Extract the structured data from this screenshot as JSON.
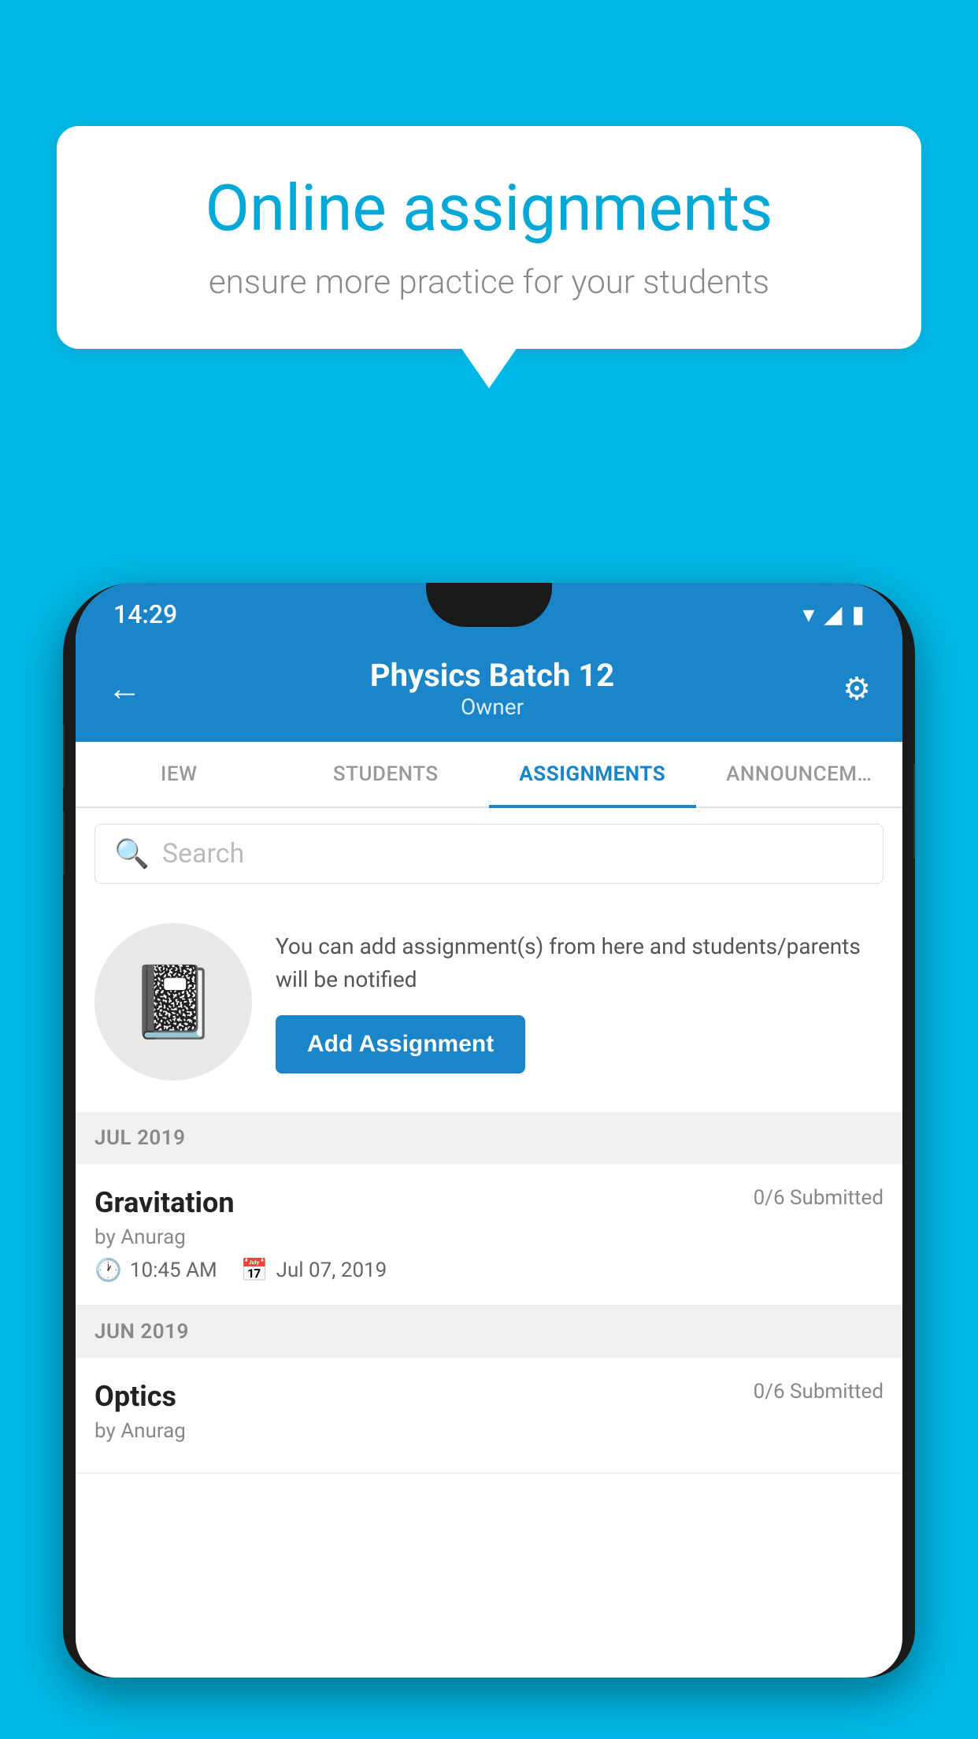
{
  "background": {
    "color": "#00B8E6"
  },
  "speech_bubble": {
    "title": "Online assignments",
    "subtitle": "ensure more practice for your students"
  },
  "status_bar": {
    "time": "14:29",
    "wifi_icon": "▾",
    "signal_icon": "▲",
    "battery_icon": "▮"
  },
  "app_header": {
    "back_label": "←",
    "title": "Physics Batch 12",
    "subtitle": "Owner",
    "settings_icon": "⚙"
  },
  "tabs": [
    {
      "label": "IEW",
      "active": false
    },
    {
      "label": "STUDENTS",
      "active": false
    },
    {
      "label": "ASSIGNMENTS",
      "active": true
    },
    {
      "label": "ANNOUNCEM…",
      "active": false
    }
  ],
  "search": {
    "placeholder": "Search"
  },
  "promo": {
    "description": "You can add assignment(s) from here and students/parents will be notified",
    "add_button_label": "Add Assignment"
  },
  "assignment_sections": [
    {
      "month_label": "JUL 2019",
      "assignments": [
        {
          "title": "Gravitation",
          "submitted": "0/6 Submitted",
          "by": "by Anurag",
          "time": "10:45 AM",
          "date": "Jul 07, 2019"
        }
      ]
    },
    {
      "month_label": "JUN 2019",
      "assignments": [
        {
          "title": "Optics",
          "submitted": "0/6 Submitted",
          "by": "by Anurag",
          "time": "",
          "date": ""
        }
      ]
    }
  ]
}
